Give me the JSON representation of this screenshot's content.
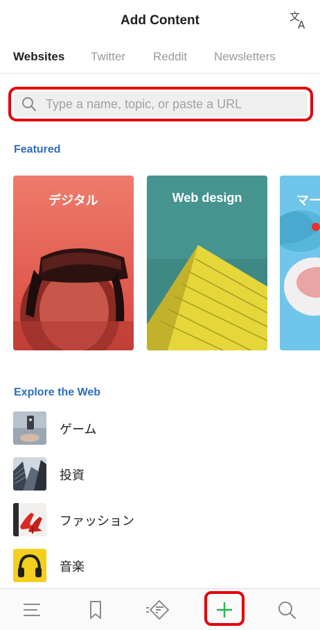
{
  "header": {
    "title": "Add Content",
    "translate_icon": "translate-icon"
  },
  "tabs": [
    {
      "label": "Websites",
      "active": true
    },
    {
      "label": "Twitter",
      "active": false
    },
    {
      "label": "Reddit",
      "active": false
    },
    {
      "label": "Newsletters",
      "active": false
    }
  ],
  "search": {
    "placeholder": "Type a name, topic, or paste a URL",
    "value": "",
    "icon": "search-icon"
  },
  "featured": {
    "label": "Featured",
    "cards": [
      {
        "label": "デジタル"
      },
      {
        "label": "Web design"
      },
      {
        "label": "マー"
      }
    ]
  },
  "explore": {
    "label": "Explore the Web",
    "items": [
      {
        "label": "ゲーム"
      },
      {
        "label": "投資"
      },
      {
        "label": "ファッション"
      },
      {
        "label": "音楽"
      }
    ]
  },
  "bottom_nav": [
    {
      "name": "menu",
      "icon": "menu-icon"
    },
    {
      "name": "saved",
      "icon": "bookmark-icon"
    },
    {
      "name": "feed",
      "icon": "feedly-icon"
    },
    {
      "name": "add",
      "icon": "plus-icon"
    },
    {
      "name": "search",
      "icon": "search-icon"
    }
  ],
  "colors": {
    "accent_blue": "#2d6cc4",
    "highlight_red": "#e4000b",
    "plus_green": "#2bb24c"
  }
}
